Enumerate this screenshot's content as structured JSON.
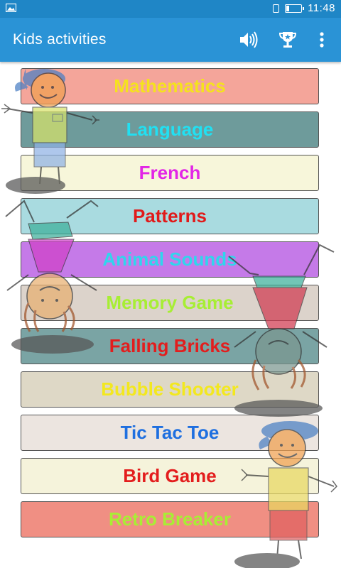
{
  "status_bar": {
    "time": "11:48"
  },
  "toolbar": {
    "title": "Kids activities",
    "sound_icon": "volume-icon",
    "trophy_icon": "trophy-icon",
    "menu_icon": "overflow-menu-icon"
  },
  "activities": [
    {
      "label": "Mathematics",
      "bg": "#f4a59a",
      "color": "#f5e21e"
    },
    {
      "label": "Language",
      "bg": "#6e9b9b",
      "color": "#21e0f2"
    },
    {
      "label": "French",
      "bg": "#f7f6da",
      "color": "#e226e6"
    },
    {
      "label": "Patterns",
      "bg": "#a9dbe0",
      "color": "#e11a1a"
    },
    {
      "label": "Animal Sounds",
      "bg": "#c57ae8",
      "color": "#2fd6ec"
    },
    {
      "label": "Memory Game",
      "bg": "#dcd3cb",
      "color": "#a7ee34"
    },
    {
      "label": "Falling Bricks",
      "bg": "#7aa4a4",
      "color": "#e31d1d"
    },
    {
      "label": "Bubble Shooter",
      "bg": "#ded8c6",
      "color": "#f3e81e"
    },
    {
      "label": "Tic Tac Toe",
      "bg": "#ece5e0",
      "color": "#1e6fe0"
    },
    {
      "label": "Bird Game",
      "bg": "#f5f3db",
      "color": "#e31d1d"
    },
    {
      "label": "Retro Breaker",
      "bg": "#f08f83",
      "color": "#a8ee34"
    }
  ]
}
